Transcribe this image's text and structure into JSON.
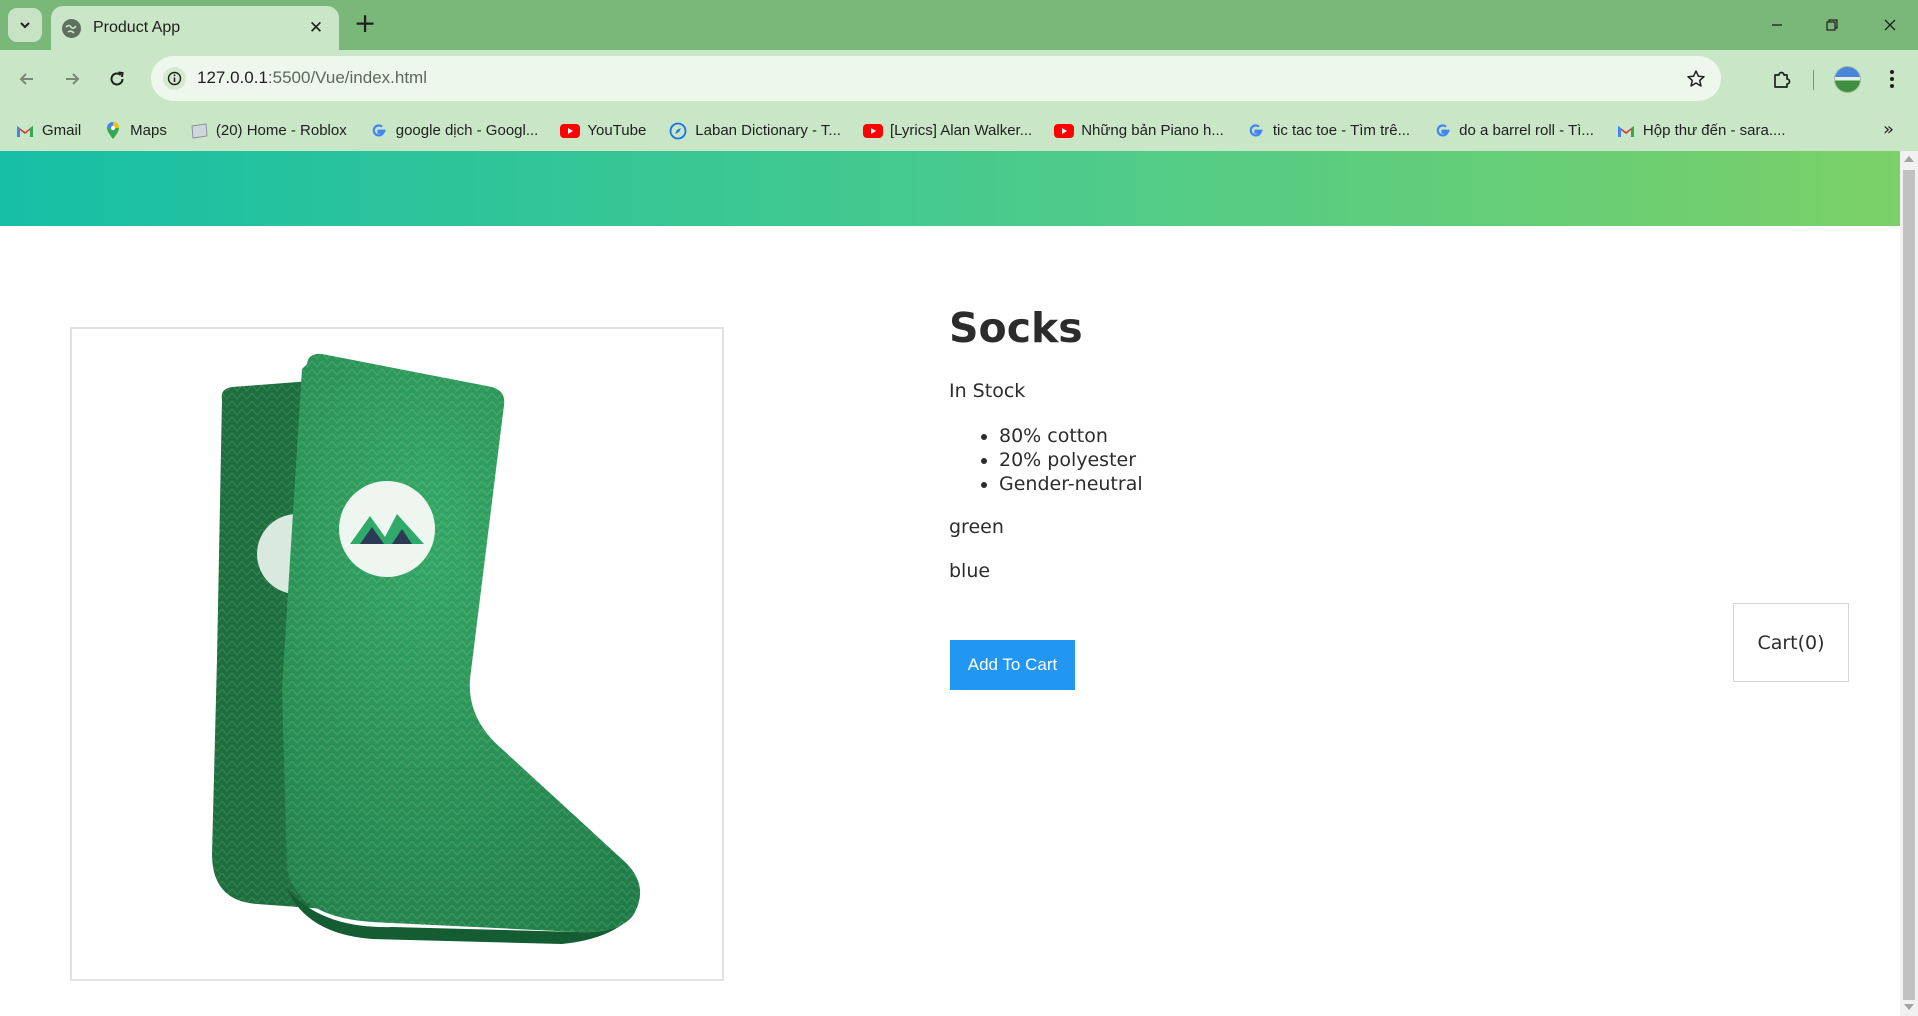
{
  "browser": {
    "tab_title": "Product App",
    "url_host": "127.0.0.1",
    "url_rest": ":5500/Vue/index.html",
    "bookmarks": [
      {
        "label": "Gmail",
        "icon": "gmail-icon"
      },
      {
        "label": "Maps",
        "icon": "maps-icon"
      },
      {
        "label": "(20) Home - Roblox",
        "icon": "roblox-icon"
      },
      {
        "label": "google dịch - Googl...",
        "icon": "google-icon"
      },
      {
        "label": "YouTube",
        "icon": "youtube-icon"
      },
      {
        "label": "Laban Dictionary - T...",
        "icon": "laban-icon"
      },
      {
        "label": "[Lyrics] Alan Walker...",
        "icon": "youtube-icon"
      },
      {
        "label": "Những bản Piano h...",
        "icon": "youtube-icon"
      },
      {
        "label": "tic tac toe - Tìm trê...",
        "icon": "google-icon"
      },
      {
        "label": "do a barrel roll - Tì...",
        "icon": "google-icon"
      },
      {
        "label": "Hộp thư đến - sara....",
        "icon": "gmail-icon"
      }
    ],
    "more_bookmarks_glyph": "»"
  },
  "colors": {
    "tabstrip": "#7ab87a",
    "toolbar": "#c9e6c6",
    "nav_gradient_start": "#16bfa6",
    "nav_gradient_end": "#7bd067",
    "button_blue": "#2196f3",
    "sock_green": "#2e9a5a"
  },
  "product": {
    "title": "Socks",
    "stock_status": "In Stock",
    "details": [
      "80% cotton",
      "20% polyester",
      "Gender-neutral"
    ],
    "variants": [
      "green",
      "blue"
    ],
    "add_to_cart_label": "Add To Cart",
    "image_icon": "green-socks-image"
  },
  "cart": {
    "label": "Cart(0)"
  }
}
